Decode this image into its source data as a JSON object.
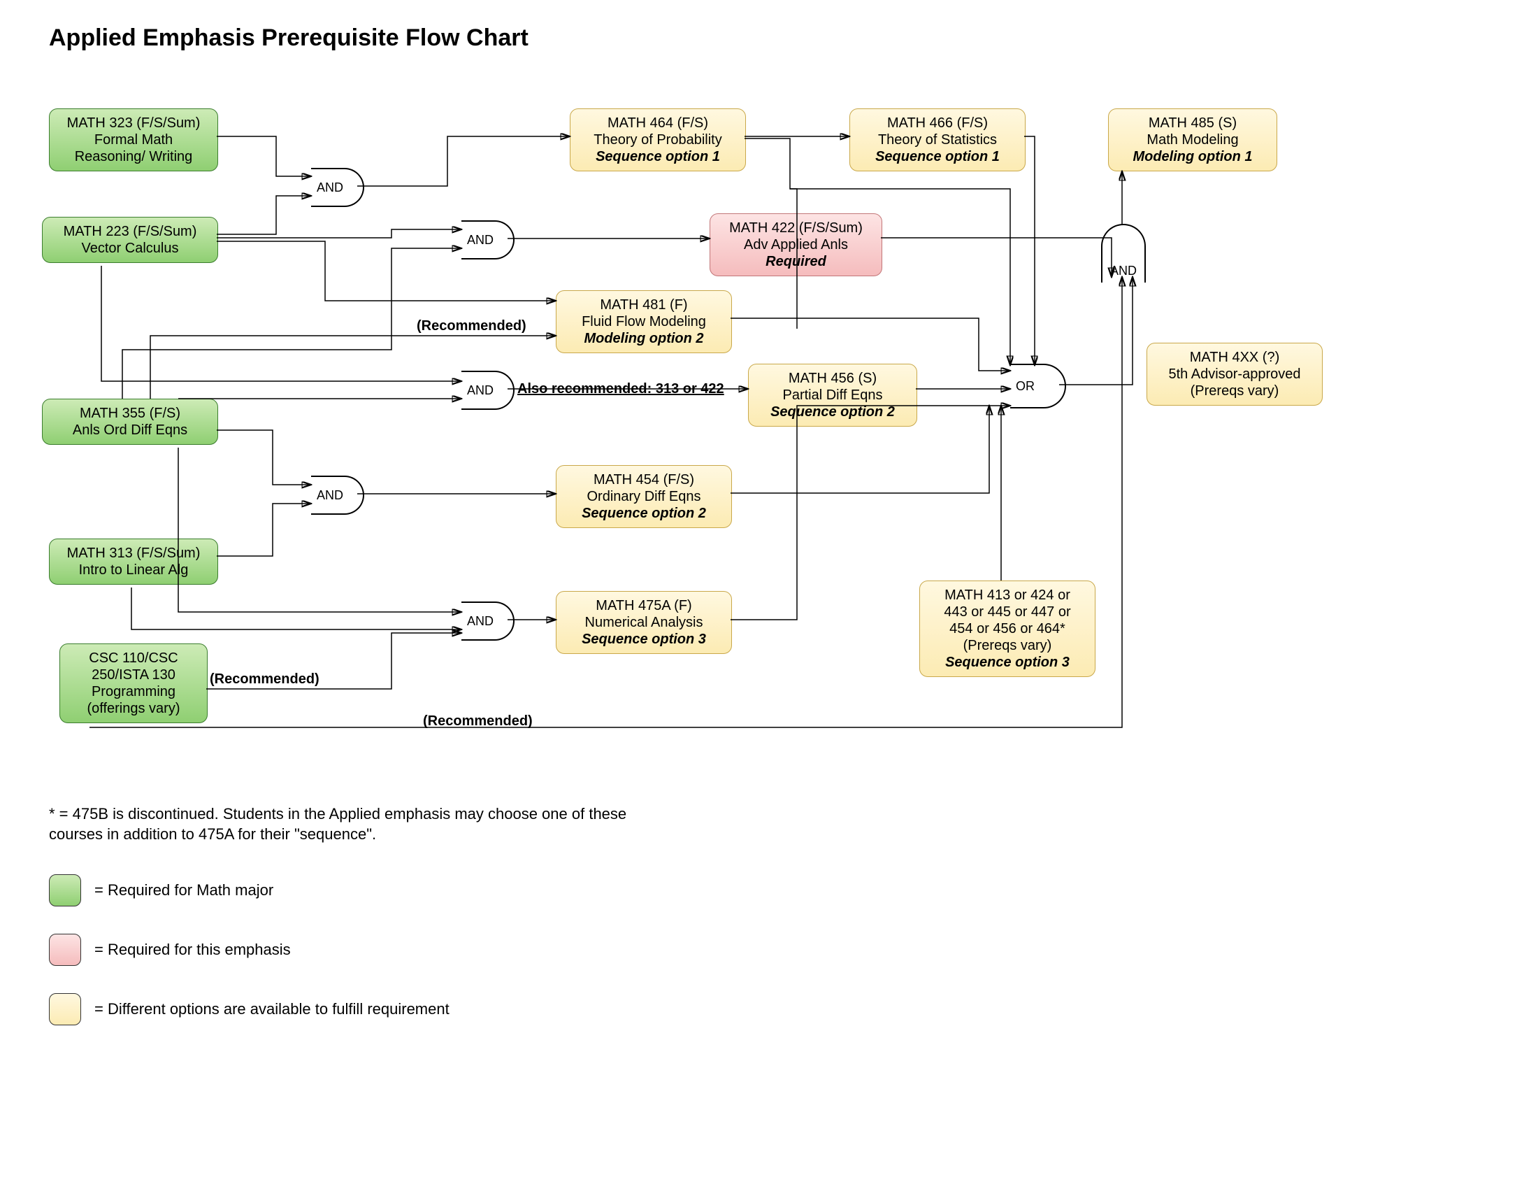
{
  "title": "Applied Emphasis Prerequisite Flow Chart",
  "nodes": {
    "n323": {
      "l1": "MATH 323 (F/S/Sum)",
      "l2": "Formal Math",
      "l3": "Reasoning/ Writing"
    },
    "n223": {
      "l1": "MATH 223 (F/S/Sum)",
      "l2": "Vector Calculus"
    },
    "n355": {
      "l1": "MATH 355 (F/S)",
      "l2": "Anls Ord Diff Eqns"
    },
    "n313": {
      "l1": "MATH 313 (F/S/Sum)",
      "l2": "Intro to Linear Alg"
    },
    "ncsc": {
      "l1": "CSC 110/CSC",
      "l2": "250/ISTA 130",
      "l3": "Programming",
      "l4": "(offerings vary)"
    },
    "n464": {
      "l1": "MATH 464 (F/S)",
      "l2": "Theory of Probability",
      "l3": "Sequence option 1"
    },
    "n466": {
      "l1": "MATH 466 (F/S)",
      "l2": "Theory of Statistics",
      "l3": "Sequence option 1"
    },
    "n485": {
      "l1": "MATH 485 (S)",
      "l2": "Math Modeling",
      "l3": "Modeling option 1"
    },
    "n422": {
      "l1": "MATH 422 (F/S/Sum)",
      "l2": "Adv Applied Anls",
      "l3": "Required"
    },
    "n481": {
      "l1": "MATH 481 (F)",
      "l2": "Fluid Flow Modeling",
      "l3": "Modeling option 2"
    },
    "n456": {
      "l1": "MATH 456 (S)",
      "l2": "Partial Diff Eqns",
      "l3": "Sequence option 2"
    },
    "n454": {
      "l1": "MATH 454 (F/S)",
      "l2": "Ordinary Diff Eqns",
      "l3": "Sequence option 2"
    },
    "n475": {
      "l1": "MATH 475A (F)",
      "l2": "Numerical Analysis",
      "l3": "Sequence option 3"
    },
    "n413": {
      "l1": "MATH 413 or 424 or",
      "l2": "443 or 445 or 447 or",
      "l3": "454 or 456 or 464*",
      "l4": "(Prereqs vary)",
      "l5": "Sequence option 3"
    },
    "n4xx": {
      "l1": "MATH 4XX (?)",
      "l2": "5th Advisor-approved",
      "l3": "(Prereqs vary)"
    }
  },
  "gates": {
    "and": "AND",
    "or": "OR"
  },
  "labels": {
    "rec1": "(Recommended)",
    "rec2": "(Recommended)",
    "rec3": "(Recommended)",
    "also": "Also recommended: 313 or 422"
  },
  "footnote": "* = 475B is discontinued. Students in the Applied emphasis may choose one of these courses in addition to 475A for their \"sequence\".",
  "legend": {
    "green": "= Required for Math major",
    "pink": "= Required for this emphasis",
    "yellow": "= Different options are available to fulfill requirement"
  }
}
